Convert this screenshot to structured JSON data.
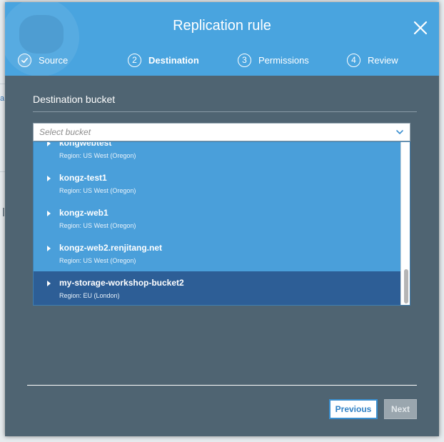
{
  "backdrop": {
    "link_fragment": "a"
  },
  "modal": {
    "title": "Replication rule",
    "close_icon": "close-icon"
  },
  "steps": [
    {
      "number": "",
      "label": "Source",
      "state": "done",
      "icon": "check-icon"
    },
    {
      "number": "2",
      "label": "Destination",
      "state": "active"
    },
    {
      "number": "3",
      "label": "Permissions",
      "state": "pending"
    },
    {
      "number": "4",
      "label": "Review",
      "state": "pending"
    }
  ],
  "destination": {
    "section_label": "Destination bucket",
    "select_placeholder": "Select bucket",
    "buckets": [
      {
        "name": "kongwebtest",
        "region": "Region: US West (Oregon)",
        "selected": false
      },
      {
        "name": "kongz-test1",
        "region": "Region: US West (Oregon)",
        "selected": false
      },
      {
        "name": "kongz-web1",
        "region": "Region: US West (Oregon)",
        "selected": false
      },
      {
        "name": "kongz-web2.renjitang.net",
        "region": "Region: US West (Oregon)",
        "selected": false
      },
      {
        "name": "my-storage-workshop-bucket2",
        "region": "Region: EU (London)",
        "selected": true
      }
    ]
  },
  "footer": {
    "previous_label": "Previous",
    "next_label": "Next"
  },
  "colors": {
    "header": "#49a4df",
    "body": "#4f6472",
    "dropdown": "#4a9fda",
    "selected_row": "#2d5e96"
  }
}
